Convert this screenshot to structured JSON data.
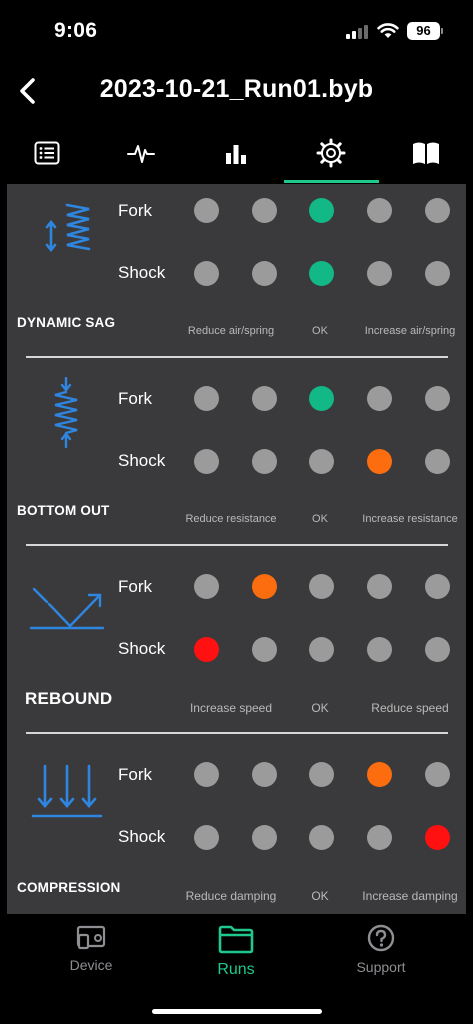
{
  "status_bar": {
    "time": "9:06",
    "battery": "96"
  },
  "header": {
    "title": "2023-10-21_Run01.byb"
  },
  "tabs": [
    {
      "icon": "list-icon",
      "active": false
    },
    {
      "icon": "activity-icon",
      "active": false
    },
    {
      "icon": "bar-chart-icon",
      "active": false
    },
    {
      "icon": "gear-icon",
      "active": true
    },
    {
      "icon": "book-icon",
      "active": false
    }
  ],
  "status_colors": {
    "neutral": "#9b9b9b",
    "ok": "#12b886",
    "warning": "#fb6d0e",
    "error": "#ff1111"
  },
  "sections": [
    {
      "title": "DYNAMIC SAG",
      "icon": "spring-sag-icon",
      "rows": [
        {
          "label": "Fork",
          "state": [
            "neutral",
            "neutral",
            "ok",
            "neutral",
            "neutral"
          ]
        },
        {
          "label": "Shock",
          "state": [
            "neutral",
            "neutral",
            "ok",
            "neutral",
            "neutral"
          ]
        }
      ],
      "scale": [
        "Reduce air/spring",
        "OK",
        "Increase air/spring"
      ]
    },
    {
      "title": "BOTTOM OUT",
      "icon": "spring-compress-icon",
      "rows": [
        {
          "label": "Fork",
          "state": [
            "neutral",
            "neutral",
            "ok",
            "neutral",
            "neutral"
          ]
        },
        {
          "label": "Shock",
          "state": [
            "neutral",
            "neutral",
            "neutral",
            "warning",
            "neutral"
          ]
        }
      ],
      "scale": [
        "Reduce resistance",
        "OK",
        "Increase resistance"
      ]
    },
    {
      "title": "REBOUND",
      "icon": "rebound-icon",
      "rows": [
        {
          "label": "Fork",
          "state": [
            "neutral",
            "warning",
            "neutral",
            "neutral",
            "neutral"
          ]
        },
        {
          "label": "Shock",
          "state": [
            "error",
            "neutral",
            "neutral",
            "neutral",
            "neutral"
          ]
        }
      ],
      "scale": [
        "Increase speed",
        "OK",
        "Reduce speed"
      ]
    },
    {
      "title": "COMPRESSION",
      "icon": "compression-icon",
      "rows": [
        {
          "label": "Fork",
          "state": [
            "neutral",
            "neutral",
            "neutral",
            "warning",
            "neutral"
          ]
        },
        {
          "label": "Shock",
          "state": [
            "neutral",
            "neutral",
            "neutral",
            "neutral",
            "error"
          ]
        }
      ],
      "scale": [
        "Reduce damping",
        "OK",
        "Increase damping"
      ]
    }
  ],
  "bottom_nav": [
    {
      "label": "Device",
      "icon": "device-icon",
      "active": false
    },
    {
      "label": "Runs",
      "icon": "folder-icon",
      "active": true
    },
    {
      "label": "Support",
      "icon": "help-icon",
      "active": false
    }
  ]
}
